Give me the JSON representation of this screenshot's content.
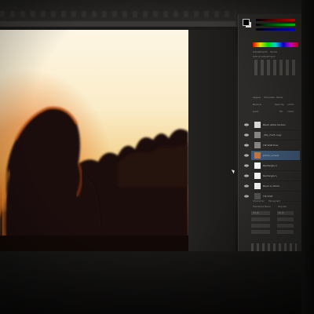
{
  "photo": {
    "description_colors": {
      "sky_light": "#fbf1d6",
      "sky_warm": "#f0c97a",
      "sun_glow": "#e8781c",
      "silhouette": "#1a0f0a",
      "hair_rim": "#c44a12"
    }
  },
  "panel": {
    "tabs": [
      "Adjustments",
      "Styles",
      "Layers",
      "Channels",
      "Paths",
      "Character",
      "Paragraph"
    ],
    "add_adjustment": "Add an adjustment",
    "blend_mode": "Normal",
    "opacity_label": "Opacity:",
    "opacity_value": "100%",
    "lock_label": "Lock:",
    "fill_label": "Fill:",
    "fill_value": "100%",
    "layers": [
      {
        "name": "Black white fashion",
        "selected": false
      },
      {
        "name": "_MG_7125 copy",
        "selected": false
      },
      {
        "name": "Tilt Shift Pow",
        "selected": false
      },
      {
        "name": "photo_sunset",
        "selected": true
      },
      {
        "name": "Rectangle 2",
        "selected": false
      },
      {
        "name": "Rectangle 1",
        "selected": false
      },
      {
        "name": "Black & White",
        "selected": false
      },
      {
        "name": "Tilt-Shift",
        "selected": false
      }
    ],
    "font_family": "Helvetica Neue",
    "font_style": "Regular",
    "font_size": "24 pt",
    "leading": "48 pt",
    "language": "English: UK"
  },
  "colors": {
    "accent_selection": "#3f5a78",
    "panel_bg": "#2c2b2a"
  },
  "icons": [
    "eye-icon",
    "cursor-icon",
    "color-swatch-icon",
    "layer-thumb-icon"
  ]
}
